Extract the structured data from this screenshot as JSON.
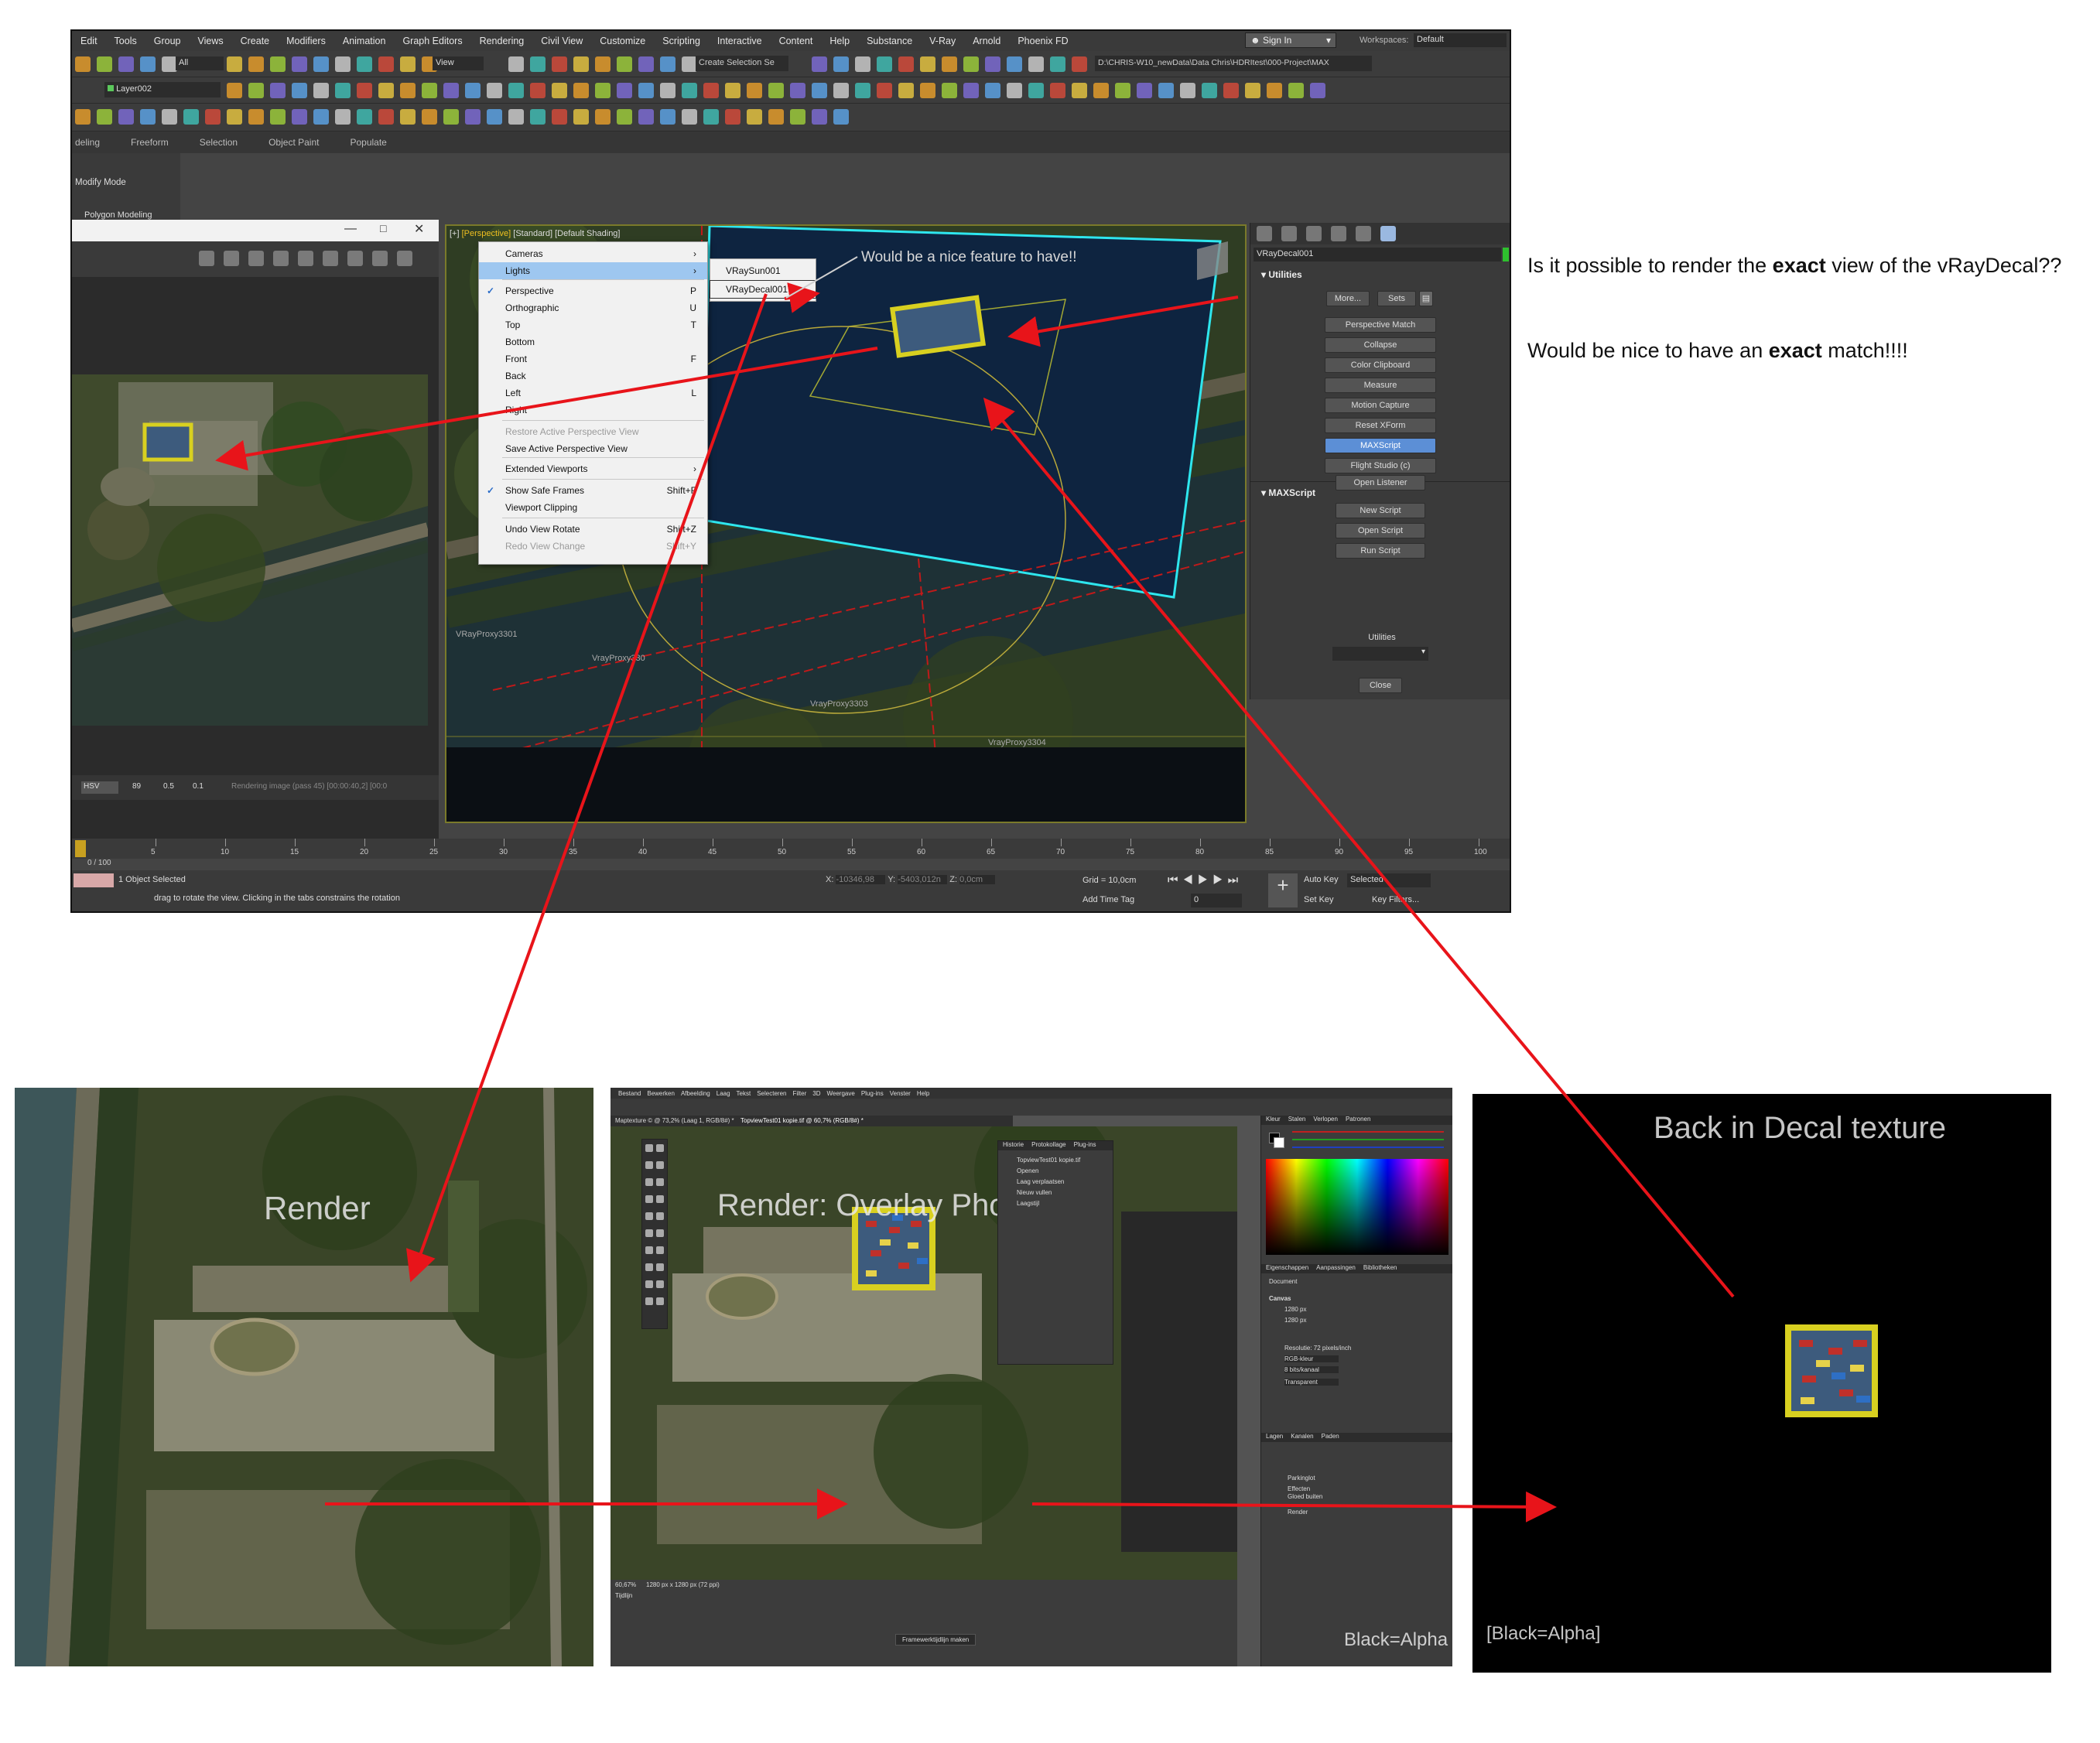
{
  "max": {
    "menu": [
      "Edit",
      "Tools",
      "Group",
      "Views",
      "Create",
      "Modifiers",
      "Animation",
      "Graph Editors",
      "Rendering",
      "Civil View",
      "Customize",
      "Scripting",
      "Interactive",
      "Content",
      "Help",
      "Substance",
      "V-Ray",
      "Arnold",
      "Phoenix FD"
    ],
    "sign_in": "Sign In",
    "workspaces_label": "Workspaces:",
    "workspaces_value": "Default",
    "filter_all": "All",
    "view_dropdown": "View",
    "create_selection": "Create Selection Se",
    "project_path": "D:\\CHRIS-W10_newData\\Data Chris\\HDRItest\\000-Project\\MAX",
    "layer": "Layer002",
    "ribbon_tabs": [
      "deling",
      "Freeform",
      "Selection",
      "Object Paint",
      "Populate"
    ],
    "modify_mode": "Modify Mode",
    "polygon_modeling": "Polygon Modeling",
    "viewport_label": {
      "plus": "[+]",
      "view": "[Perspective]",
      "std": "[Standard]",
      "shading": "[Default Shading]"
    },
    "proxies": [
      "VRayProxy3301",
      "VrayProxy330",
      "VrayProxy3303",
      "VrayProxy3304"
    ],
    "frame_buffer": {
      "hsv": "HSV",
      "v1": "89",
      "v2": "0.5",
      "v3": "0.1",
      "status": "Rendering image (pass 45) [00:00:40,2] [00:0"
    }
  },
  "context_menu": {
    "items": [
      {
        "label": "Cameras",
        "shortcut": "",
        "arrow": true
      },
      {
        "label": "Lights",
        "shortcut": "",
        "arrow": true
      },
      {
        "label": "Perspective",
        "shortcut": "P",
        "check": true
      },
      {
        "label": "Orthographic",
        "shortcut": "U"
      },
      {
        "label": "Top",
        "shortcut": "T"
      },
      {
        "label": "Bottom",
        "shortcut": ""
      },
      {
        "label": "Front",
        "shortcut": "F"
      },
      {
        "label": "Back",
        "shortcut": ""
      },
      {
        "label": "Left",
        "shortcut": "L"
      },
      {
        "label": "Right",
        "shortcut": ""
      },
      {
        "label": "Restore Active Perspective View",
        "shortcut": "",
        "disabled": true
      },
      {
        "label": "Save Active Perspective View",
        "shortcut": ""
      },
      {
        "label": "Extended Viewports",
        "shortcut": "",
        "arrow": true
      },
      {
        "label": "Show Safe Frames",
        "shortcut": "Shift+F",
        "check": true
      },
      {
        "label": "Viewport Clipping",
        "shortcut": ""
      },
      {
        "label": "Undo View Rotate",
        "shortcut": "Shift+Z"
      },
      {
        "label": "Redo View Change",
        "shortcut": "Shift+Y",
        "disabled": true
      }
    ],
    "submenu": [
      "VRaySun001",
      "VRayDecal001"
    ]
  },
  "command_panel": {
    "object_name": "VRayDecal001",
    "utilities_title": "Utilities",
    "more": "More...",
    "sets": "Sets",
    "utility_buttons": [
      "Perspective Match",
      "Collapse",
      "Color Clipboard",
      "Measure",
      "Motion Capture",
      "Reset XForm",
      "MAXScript",
      "Flight Studio (c)"
    ],
    "maxscript_title": "MAXScript",
    "maxscript_buttons": [
      "Open Listener",
      "New Script",
      "Open Script",
      "Run Script"
    ],
    "utilities_label": "Utilities",
    "close": "Close"
  },
  "timeline": {
    "frame": "0 / 100",
    "ticks": [
      "5",
      "10",
      "15",
      "20",
      "25",
      "30",
      "35",
      "40",
      "45",
      "50",
      "55",
      "60",
      "65",
      "70",
      "75",
      "80",
      "85",
      "90",
      "95",
      "100"
    ]
  },
  "status": {
    "selected": "1 Object Selected",
    "prompt": "drag to rotate the view.  Clicking in the tabs constrains the rotation",
    "x_label": "X:",
    "x": "-10346,98",
    "y_label": "Y:",
    "y": "-5403,012n",
    "z_label": "Z:",
    "z": "0,0cm",
    "grid": "Grid = 10,0cm",
    "add_time_tag": "Add Time Tag",
    "auto_key": "Auto Key",
    "selected_dropdown": "Selected",
    "set_key": "Set Key",
    "key_filters": "Key Filters...",
    "frame_value": "0"
  },
  "annotations": {
    "feature": "Would be a nice feature to have!!",
    "q1_pre": "Is it possible to render the ",
    "q1_bold": "exact",
    "q1_post": "  view of the vRayDecal??",
    "q2_pre": "Would be nice  to have an ",
    "q2_bold": "exact",
    "q2_post": " match!!!!"
  },
  "panels": {
    "render_label": "Render",
    "overlay_label": "Render: Overlay Photoshop",
    "decal_label": "Back in Decal texture",
    "black_alpha_1": "Black=Alpha",
    "black_alpha_2": "[Black=Alpha]"
  },
  "photoshop": {
    "menu": [
      "Bestand",
      "Bewerken",
      "Afbeelding",
      "Laag",
      "Tekst",
      "Selecteren",
      "Filter",
      "3D",
      "Weergave",
      "Plug-ins",
      "Venster",
      "Help"
    ],
    "tab1": "Maptexture © @ 73,2% (Laag 1, RGB/8#) *",
    "tab2": "TopviewTest01 kopie.tif @ 60,7% (RGB/8#) *",
    "history_tabs": [
      "Historie",
      "Protokollage",
      "Plug-ins"
    ],
    "history_items": [
      "TopviewTest01 kopie.tif",
      "Openen",
      "Laag verplaatsen",
      "Nieuw vullen",
      "Laagstijl"
    ],
    "color_tabs": [
      "Kleur",
      "Stalen",
      "Verlopen",
      "Patronen"
    ],
    "props_tabs": [
      "Eigenschappen",
      "Aanpassingen",
      "Bibliotheken"
    ],
    "props_doc": "Document",
    "canvas": "Canvas",
    "w": "1280 px",
    "h": "1280 px",
    "res": "Resolutie: 72 pixels/inch",
    "mode": "RGB-kleur",
    "bits": "8 bits/kanaal",
    "fill": "Transparent",
    "layers_tabs": [
      "Lagen",
      "Kanalen",
      "Paden"
    ],
    "layers": [
      "Parkinglot",
      "Effecten",
      "Gloed buiten",
      "Render"
    ],
    "zoom": "60,67%",
    "size": "1280 px x 1280 px (72 ppi)",
    "timeline_title": "Tijdlijn",
    "timeline_btn": "Framewerktijdlijn maken"
  },
  "colors": {
    "arrow": "#e8141a",
    "viewport_border": "#7a7a2a",
    "decal_glow": "#d8d020",
    "highlight": "#5c8fd6",
    "cyan": "#2ee6ee"
  }
}
